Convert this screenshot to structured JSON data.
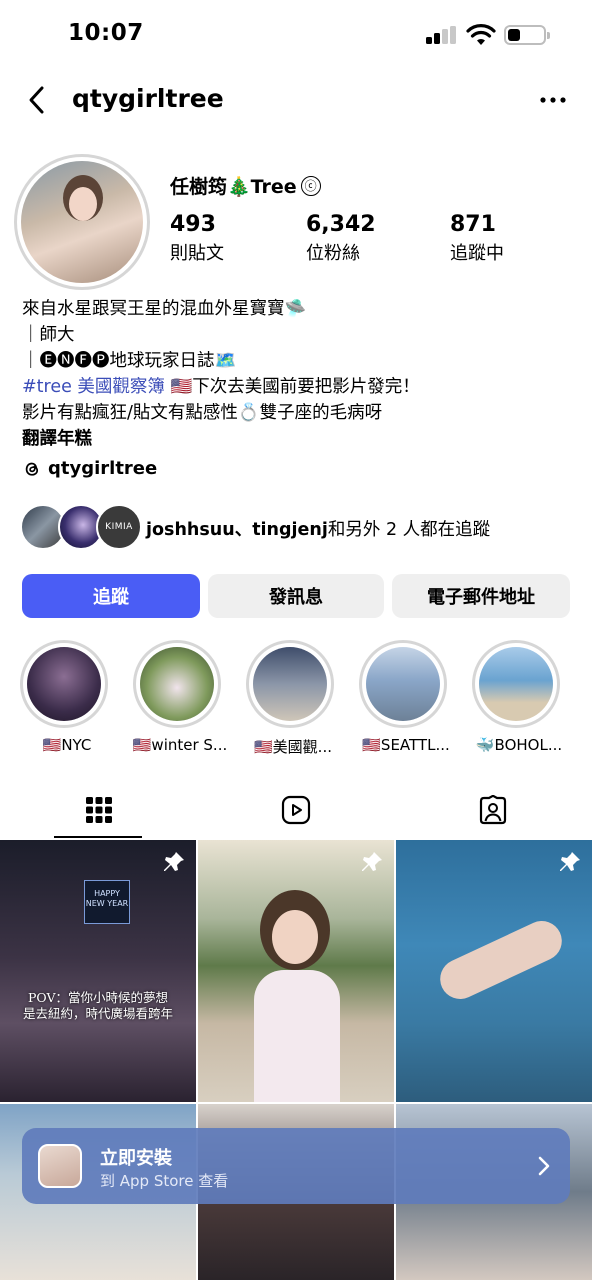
{
  "status_bar": {
    "time": "10:07",
    "battery_level": 0.35
  },
  "header": {
    "username": "qtygirltree",
    "back_icon": "chevron-left-icon",
    "more_icon": "more-horizontal-icon"
  },
  "profile": {
    "display_name": "任樹筠🎄Tree",
    "verified_symbol": "ⓒ",
    "stats": [
      {
        "value": "493",
        "label": "則貼文"
      },
      {
        "value": "6,342",
        "label": "位粉絲"
      },
      {
        "value": "871",
        "label": "追蹤中"
      }
    ],
    "bio": {
      "line1": "來自水星跟冥王星的混血外星寶寶🛸",
      "line2": "｜師大",
      "line3": "｜🅔🅝🅕🅟地球玩家日誌🗺️",
      "line4_tag": "#tree 美國觀察簿",
      "line4_rest": " 🇺🇸下次去美國前要把影片發完！",
      "line5": "影片有點瘋狂/貼文有點感性💍雙子座的毛病呀",
      "line6": "翻譯年糕"
    },
    "threads_handle": "qtygirltree",
    "followed_by": {
      "names": "joshhsuu、tingjenj",
      "suffix": "和另外 2 人都在追蹤",
      "third_avatar_text": "KIMIA"
    }
  },
  "actions": {
    "follow": "追蹤",
    "message": "發訊息",
    "email": "電子郵件地址"
  },
  "highlights": [
    {
      "label": "🇺🇸NYC",
      "color": "#4b3a5e"
    },
    {
      "label": "🇺🇸winter S...",
      "color": "#6f8f4e"
    },
    {
      "label": "🇺🇸美國觀...",
      "color": "#7c8aa0"
    },
    {
      "label": "🇺🇸SEATTL...",
      "color": "#8aa4c4"
    },
    {
      "label": "🐳BOHOL...",
      "color": "#5f9ac7"
    }
  ],
  "tabs": [
    {
      "name": "grid",
      "icon": "grid-icon"
    },
    {
      "name": "reels",
      "icon": "reels-icon"
    },
    {
      "name": "tagged",
      "icon": "tagged-person-icon"
    }
  ],
  "posts": [
    {
      "caption_line1": "POV：當你小時候的夢想",
      "caption_line2": "是去紐約，時代廣場看跨年",
      "sign_text": "HAPPY NEW YEAR",
      "pinned": true
    },
    {
      "pinned": true
    },
    {
      "pinned": true
    }
  ],
  "install_banner": {
    "title": "立即安裝",
    "subtitle": "到 App Store 查看"
  }
}
